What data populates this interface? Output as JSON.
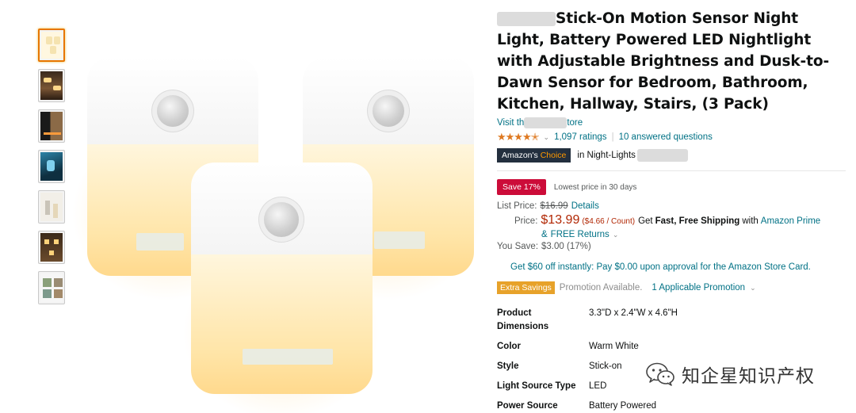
{
  "thumbnails": [
    {
      "name": "thumb-1",
      "active": true
    },
    {
      "name": "thumb-2",
      "active": false
    },
    {
      "name": "thumb-3",
      "active": false
    },
    {
      "name": "thumb-4",
      "active": false
    },
    {
      "name": "thumb-5",
      "active": false
    },
    {
      "name": "thumb-6",
      "active": false
    },
    {
      "name": "thumb-7",
      "active": false
    }
  ],
  "product": {
    "title": "Stick-On Motion Sensor Night Light, Battery Powered LED Nightlight with Adjustable Brightness and Dusk-to-Dawn Sensor for Bedroom, Bathroom, Kitchen, Hallway, Stairs, (3 Pack)",
    "store_prefix": "Visit th",
    "store_suffix": "tore",
    "star_icon": "star-rating-4.5",
    "ratings": "1,097 ratings",
    "divider": "|",
    "answered": "10 answered questions",
    "choice_label": "Amazon's",
    "choice_label_accent": "Choice",
    "choice_category": "in Night-Lights"
  },
  "pricing": {
    "save_badge": "Save 17%",
    "lowest": "Lowest price in 30 days",
    "list_label": "List Price:",
    "list_price": "$16.99",
    "details": "Details",
    "price_label": "Price:",
    "price": "$13.99",
    "per_count": "($4.66 / Count)",
    "get_fast": "Get",
    "fast_shipping": "Fast, Free Shipping",
    "with": "with",
    "prime": "Amazon Prime",
    "amp": "&",
    "free_returns": "FREE Returns",
    "you_save_label": "You Save:",
    "you_save": "$3.00 (17%)"
  },
  "credit_offer": "Get $60 off instantly: Pay $0.00 upon approval for the Amazon Store Card.",
  "promotion": {
    "badge": "Extra Savings",
    "available": "Promotion Available.",
    "applicable": "1 Applicable Promotion"
  },
  "specs": [
    {
      "key": "Product Dimensions",
      "value": "3.3\"D x 2.4\"W x 4.6\"H"
    },
    {
      "key": "Color",
      "value": "Warm White"
    },
    {
      "key": "Style",
      "value": "Stick-on"
    },
    {
      "key": "Light Source Type",
      "value": "LED"
    },
    {
      "key": "Power Source",
      "value": "Battery Powered"
    }
  ],
  "watermark": {
    "icon": "wechat-icon",
    "text": "知企星知识产权"
  },
  "colors": {
    "link": "#007185",
    "price": "#b12704",
    "badge_red": "#cc0c39",
    "extra_orange": "#e7a22a",
    "star": "#de7921",
    "choice_bg": "#232f3e"
  }
}
